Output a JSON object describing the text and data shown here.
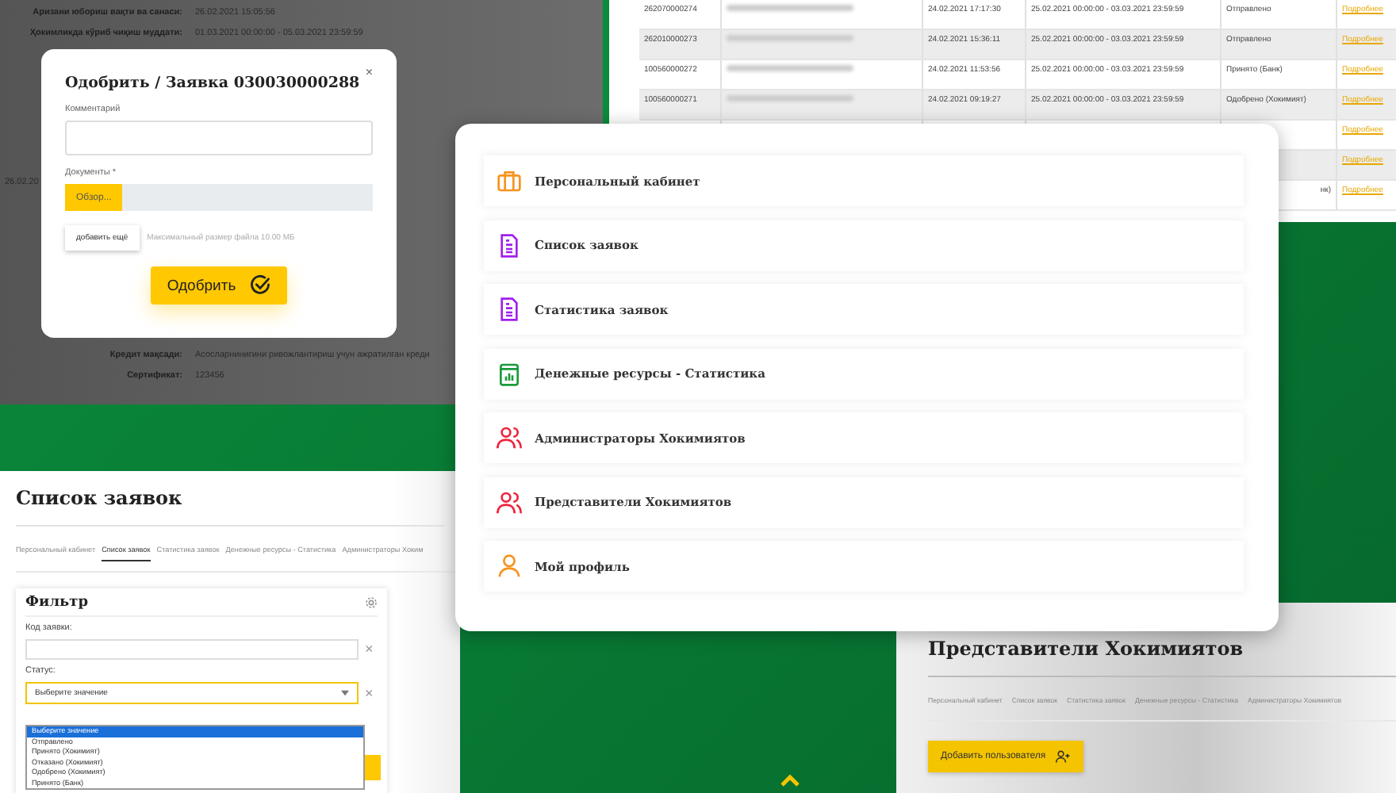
{
  "detail_page": {
    "rows_top": [
      {
        "label": "Аризани юбориш вақти ва санаси:",
        "value": "26.02.2021 15:05:56"
      },
      {
        "label": "Ҳокимликда кўриб чиқиш муддати:",
        "value": "01.03.2021 00:00:00 - 05.03.2021 23:59:59"
      }
    ],
    "side_cell": "26.02.20",
    "rows_bottom": [
      {
        "label": "Кредит мақсади:",
        "value": "Асосларнинигини ривожлантириш учун ажратилган креди"
      },
      {
        "label": "Сертификат:",
        "value": "123456"
      }
    ]
  },
  "approve_dialog": {
    "title": "Одобрить / Заявка 030030000288",
    "close": "×",
    "comment_label": "Комментарий",
    "documents_label": "Документы *",
    "browse_button": "Обзор...",
    "add_more_button": "добавить ещё",
    "max_size_note": "Максимальный размер файла 10.00 МБ",
    "submit_button": "Одобрить"
  },
  "requests_table": {
    "rows": [
      {
        "code": "262070000274",
        "date": "24.02.2021 17:17:30",
        "period": "25.02.2021 00:00:00 - 03.03.2021 23:59:59",
        "status": "Отправлено",
        "link": "Подробнее"
      },
      {
        "code": "262010000273",
        "date": "24.02.2021 15:36:11",
        "period": "25.02.2021 00:00:00 - 03.03.2021 23:59:59",
        "status": "Отправлено",
        "link": "Подробнее"
      },
      {
        "code": "100560000272",
        "date": "24.02.2021 11:53:56",
        "period": "25.02.2021 00:00:00 - 03.03.2021 23:59:59",
        "status": "Принято (Банк)",
        "link": "Подробнее"
      },
      {
        "code": "100560000271",
        "date": "24.02.2021 09:19:27",
        "period": "25.02.2021 00:00:00 - 03.03.2021 23:59:59",
        "status": "Одобрено (Хокимият)",
        "link": "Подробнее"
      },
      {
        "code": "",
        "date": "",
        "period": "",
        "status": "",
        "link": "Подробнее"
      },
      {
        "code": "",
        "date": "",
        "period": "",
        "status": "",
        "link": "Подробнее"
      },
      {
        "code": "",
        "date": "",
        "period": "",
        "status": "нк)",
        "link": "Подробнее"
      }
    ]
  },
  "menu": {
    "items": [
      {
        "label": "Персональный кабинет",
        "kind": "briefcase",
        "color": "#f7931e"
      },
      {
        "label": "Список заявок",
        "kind": "document",
        "color": "#a020f0"
      },
      {
        "label": "Статистика заявок",
        "kind": "document",
        "color": "#a020f0"
      },
      {
        "label": "Денежные ресурсы - Статистика",
        "kind": "chart",
        "color": "#1a9a3a"
      },
      {
        "label": "Администраторы Хокимиятов",
        "kind": "users",
        "color": "#f0233c"
      },
      {
        "label": "Представители Хокимиятов",
        "kind": "users",
        "color": "#f0233c"
      },
      {
        "label": "Мой профиль",
        "kind": "user",
        "color": "#f7931e"
      }
    ]
  },
  "list_page": {
    "title": "Список заявок",
    "tabs": [
      {
        "label": "Персональный кабинет",
        "selected": false
      },
      {
        "label": "Список заявок",
        "selected": true
      },
      {
        "label": "Статистика заявок",
        "selected": false
      },
      {
        "label": "Денежные ресурсы - Статистика",
        "selected": false
      },
      {
        "label": "Администраторы Хоким",
        "selected": false
      }
    ],
    "filter": {
      "title": "Фильтр",
      "code_label": "Код заявки:",
      "status_label": "Статус:",
      "status_value": "Выберите значение",
      "clear": "×",
      "options": [
        {
          "label": "Выберите значение",
          "selected": true
        },
        {
          "label": "Отправлено",
          "selected": false
        },
        {
          "label": "Принято (Хокимият)",
          "selected": false
        },
        {
          "label": "Отказано (Хокимият)",
          "selected": false
        },
        {
          "label": "Одобрено (Хокимият)",
          "selected": false
        },
        {
          "label": "Принято (Банк)",
          "selected": false
        }
      ]
    }
  },
  "reps_page": {
    "title": "Представители Хокимиятов",
    "tabs": [
      {
        "label": "Персональный кабинет",
        "selected": false
      },
      {
        "label": "Список заявок",
        "selected": false
      },
      {
        "label": "Статистика заявок",
        "selected": false
      },
      {
        "label": "Денежные ресурсы - Статистика",
        "selected": false
      },
      {
        "label": "Администраторы Хокимиятов",
        "selected": false
      }
    ],
    "add_button": "Добавить пользователя"
  }
}
